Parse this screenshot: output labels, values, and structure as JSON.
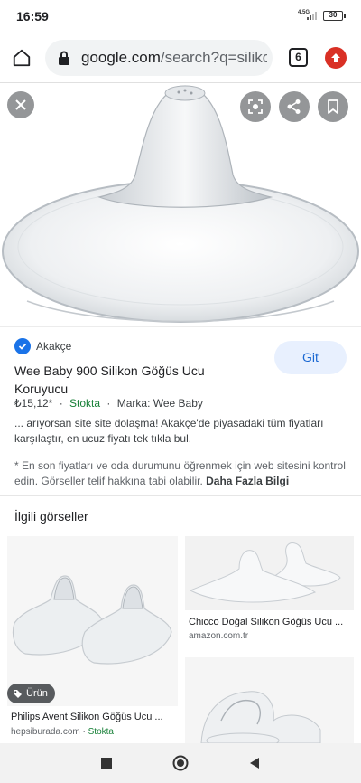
{
  "status_bar": {
    "time": "16:59",
    "network": "4.5G",
    "battery": "30"
  },
  "browser": {
    "url_host": "google.com",
    "url_path": "/search?q=silikon",
    "tab_count": "6"
  },
  "result": {
    "source": "Akakçe",
    "visit_label": "Git",
    "title": "Wee Baby 900 Silikon Göğüs Ucu Koruyucu",
    "price": "₺15,12*",
    "separator": "·",
    "stock": "Stokta",
    "brand": "Marka: Wee Baby",
    "description": "... arıyorsan site site dolaşma! Akakçe'de piyasadaki tüm fiyatları karşılaştır, en ucuz fiyatı tek tıkla bul.",
    "disclaimer": "* En son fiyatları ve oda durumunu öğrenmek için web sitesini kontrol edin. Görseller telif hakkına tabi olabilir.",
    "more_label": "Daha Fazla Bilgi"
  },
  "related": {
    "title": "İlgili görseller",
    "items": [
      {
        "title": "Philips Avent Silikon Göğüs Ucu ...",
        "source": "hepsiburada.com",
        "separator": "·",
        "stock": "Stokta",
        "badge": "Ürün"
      },
      {
        "title": "Chicco Doğal Silikon Göğüs Ucu ...",
        "source": "amazon.com.tr"
      }
    ]
  },
  "colors": {
    "accent": "#1a73e8",
    "stock": "#188038",
    "update_badge": "#d93025"
  },
  "icons": [
    "home-icon",
    "lock-icon",
    "tabs-icon",
    "update-icon",
    "close-icon",
    "lens-icon",
    "share-icon",
    "bookmark-icon",
    "verified-icon",
    "tag-icon",
    "recents-icon",
    "home-nav-icon",
    "back-icon"
  ]
}
